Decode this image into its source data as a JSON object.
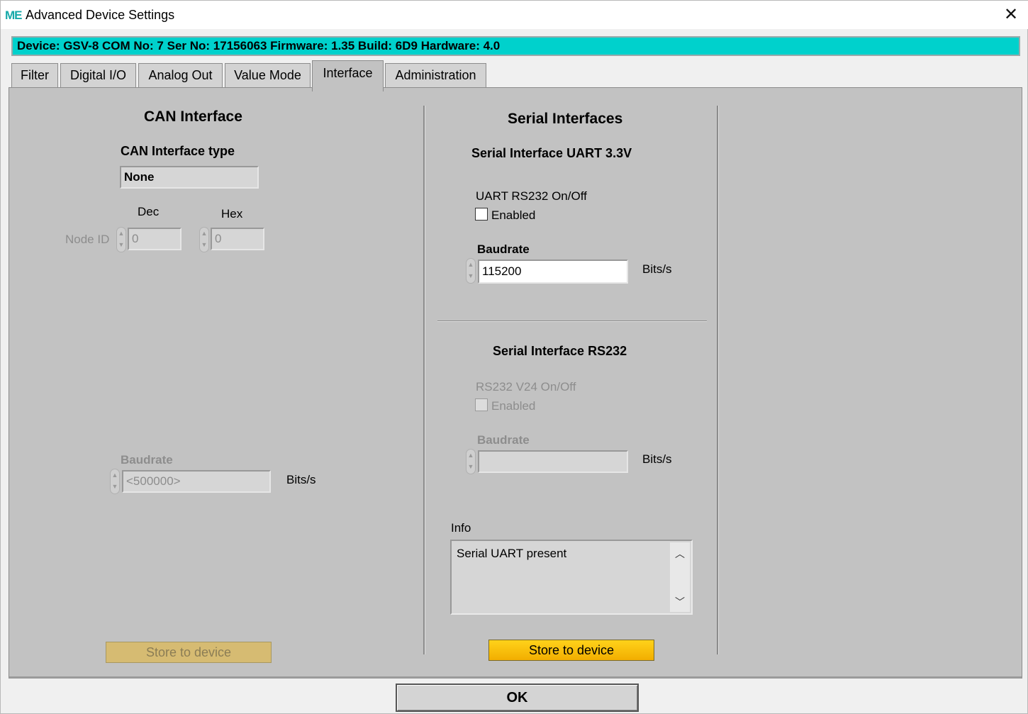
{
  "window": {
    "logo_text": "ME",
    "title": "Advanced Device Settings",
    "close_glyph": "✕"
  },
  "device_bar": {
    "text": "Device: GSV-8 COM No: 7 Ser No: 17156063 Firmware: 1.35 Build: 6D9 Hardware: 4.0"
  },
  "tabs": [
    {
      "label": "Filter",
      "active": false
    },
    {
      "label": "Digital I/O",
      "active": false
    },
    {
      "label": "Analog Out",
      "active": false
    },
    {
      "label": "Value Mode",
      "active": false
    },
    {
      "label": "Interface",
      "active": true
    },
    {
      "label": "Administration",
      "active": false
    }
  ],
  "can": {
    "title": "CAN Interface",
    "type_label": "CAN Interface type",
    "type_value": "None",
    "dec_label": "Dec",
    "hex_label": "Hex",
    "node_id_label": "Node ID",
    "node_id_dec": "0",
    "node_id_hex": "0",
    "baudrate_label": "Baudrate",
    "baudrate_value": "<500000>",
    "baudrate_unit": "Bits/s",
    "store_label": "Store to device"
  },
  "serial": {
    "title": "Serial Interfaces",
    "uart_title": "Serial Interface UART 3.3V",
    "uart_onoff_label": "UART RS232 On/Off",
    "uart_enabled_label": "Enabled",
    "uart_baudrate_label": "Baudrate",
    "uart_baudrate_value": "115200",
    "uart_baudrate_unit": "Bits/s",
    "rs232_title": "Serial Interface RS232",
    "rs232_onoff_label": "RS232 V24 On/Off",
    "rs232_enabled_label": "Enabled",
    "rs232_baudrate_label": "Baudrate",
    "rs232_baudrate_value": "",
    "rs232_baudrate_unit": "Bits/s",
    "info_label": "Info",
    "info_text": "Serial UART present",
    "store_label": "Store to device"
  },
  "footer": {
    "ok_label": "OK"
  },
  "colors": {
    "device_bar": "#00d1cc",
    "store_button": "#ffc20e",
    "panel": "#c2c2c2"
  }
}
